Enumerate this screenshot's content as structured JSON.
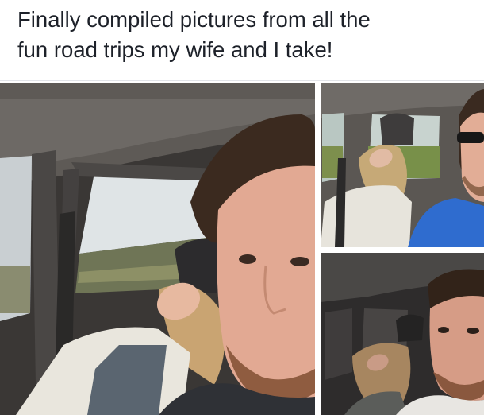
{
  "post": {
    "caption_line1": "Finally compiled pictures from all the",
    "caption_line2": "fun road trips my wife and I take!"
  },
  "photos": [
    {
      "id": "main",
      "description_icon": "car-selfie-photo"
    },
    {
      "id": "top-right",
      "description_icon": "car-selfie-photo"
    },
    {
      "id": "bottom-right",
      "description_icon": "car-selfie-photo"
    }
  ],
  "colors": {
    "caption_text": "#1d2129",
    "background": "#ffffff",
    "divider": "#e3e5ea"
  }
}
